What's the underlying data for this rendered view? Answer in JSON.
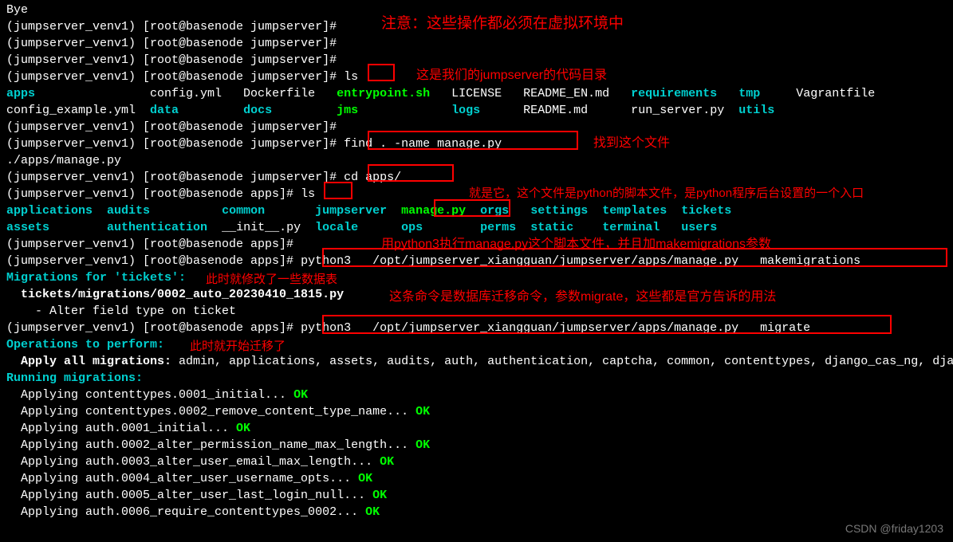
{
  "lines": {
    "bye": "Bye",
    "prompt_js": "(jumpserver_venv1) [root@basenode jumpserver]# ",
    "prompt_apps": "(jumpserver_venv1) [root@basenode apps]# ",
    "ls": "ls",
    "find": "find . -name manage.py",
    "find_result": "./apps/manage.py",
    "cd": "cd apps/",
    "py_make": "python3   /opt/jumpserver_xiangguan/jumpserver/apps/manage.py   makemigrations",
    "py_migrate": "python3   /opt/jumpserver_xiangguan/jumpserver/apps/manage.py   migrate",
    "mig_for": "Migrations for 'tickets':",
    "mig_file": "  tickets/migrations/0002_auto_20230410_1815.py",
    "mig_alter": "    - Alter field type on ticket",
    "ops_to": "Operations to perform:",
    "apply_all": "  Apply all migrations:",
    "apply_all_list": " admin, applications, assets, audits, auth, authentication, captcha, common, contenttypes, django_cas_ng, django_celery_beat, jms_oidc_rp, ops, orgs, perms, sessions, settings, terminal, tickets, users",
    "running": "Running migrations:",
    "m1": "  Applying contenttypes.0001_initial... ",
    "m2": "  Applying contenttypes.0002_remove_content_type_name... ",
    "m3": "  Applying auth.0001_initial... ",
    "m4": "  Applying auth.0002_alter_permission_name_max_length... ",
    "m5": "  Applying auth.0003_alter_user_email_max_length... ",
    "m6": "  Applying auth.0004_alter_user_username_opts... ",
    "m7": "  Applying auth.0005_alter_user_last_login_null... ",
    "m8": "  Applying auth.0006_require_contenttypes_0002... ",
    "ok": "OK"
  },
  "ls1": {
    "apps": "apps",
    "configyml": "config.yml",
    "docker": "Dockerfile",
    "entry": "entrypoint.sh",
    "license": "LICENSE",
    "readmeen": "README_EN.md",
    "requirements": "requirements",
    "tmp": "tmp",
    "vagrant": "Vagrantfile",
    "configex": "config_example.yml",
    "data": "data",
    "docs": "docs",
    "jms": "jms",
    "logs": "logs",
    "readme": "README.md",
    "runserver": "run_server.py",
    "utils": "utils"
  },
  "ls2": {
    "applications": "applications",
    "audits": "audits",
    "common": "common",
    "jumpserver": "jumpserver",
    "manage": "manage.py",
    "orgs": "orgs",
    "settings": "settings",
    "templates": "templates",
    "tickets": "tickets",
    "assets": "assets",
    "authentication": "authentication",
    "init": "__init__.py",
    "locale": "locale",
    "ops": "ops",
    "perms": "perms",
    "static": "static",
    "terminal": "terminal",
    "users": "users"
  },
  "annot": {
    "a1": "注意：这些操作都必须在虚拟环境中",
    "a2": "这是我们的jumpserver的代码目录",
    "a3": "找到这个文件",
    "a4": "就是它，这个文件是python的脚本文件，是python程序后台设置的一个入口",
    "a5": "用python3执行manage.py这个脚本文件，并且加makemigrations参数",
    "a6": "此时就修改了一些数据表",
    "a7": "这条命令是数据库迁移命令，参数migrate，这些都是官方告诉的用法",
    "a8": "此时就开始迁移了"
  },
  "watermark": "CSDN @friday1203"
}
